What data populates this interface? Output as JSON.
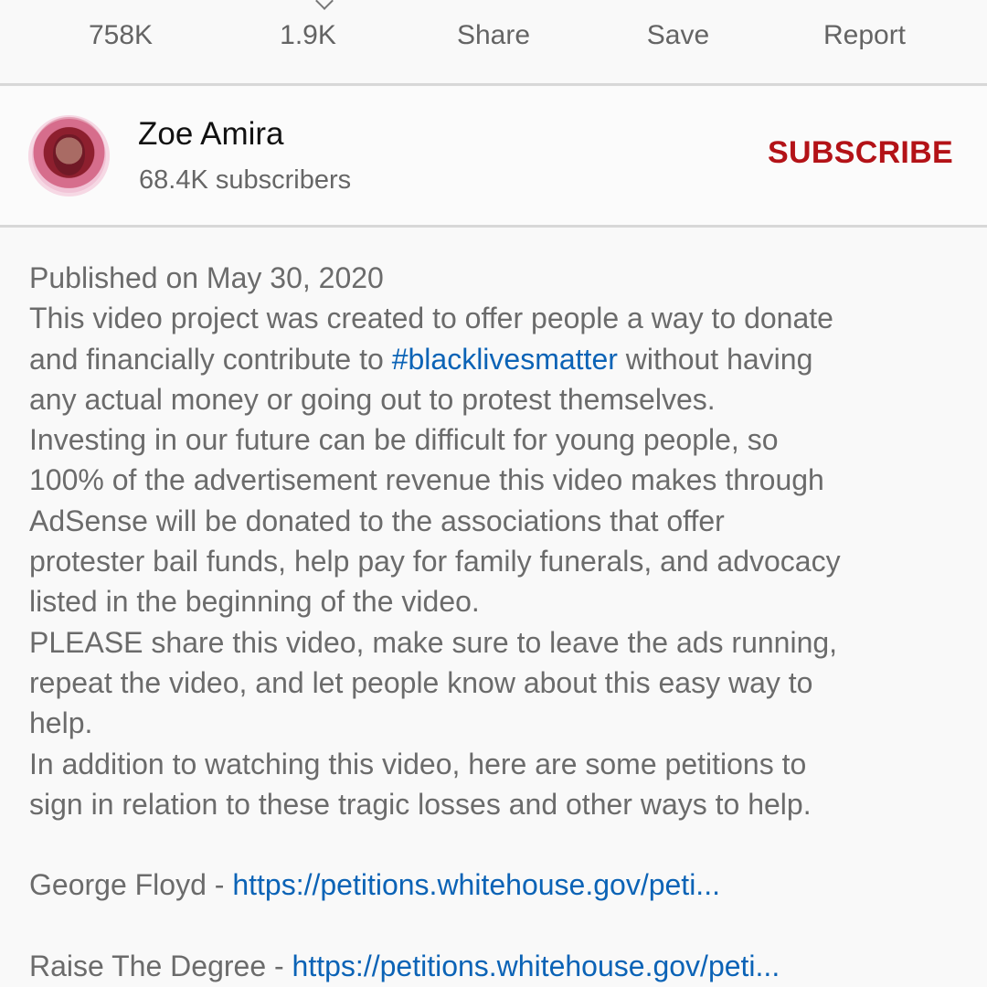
{
  "actions": {
    "likes": "758K",
    "dislikes": "1.9K",
    "share": "Share",
    "save": "Save",
    "report": "Report"
  },
  "channel": {
    "name": "Zoe Amira",
    "subscribers": "68.4K subscribers",
    "subscribe_label": "SUBSCRIBE"
  },
  "description": {
    "published": "Published on May 30, 2020",
    "line1": "This video project was created to offer people a way to donate",
    "line2_before": "and financially contribute to ",
    "hashtag": "#blacklivesmatter",
    "line2_after": " without having",
    "line3": "any actual money or going out to protest themselves.",
    "line4": "Investing in our future can be difficult for young people, so",
    "line5": "100% of the advertisement revenue this video makes through",
    "line6": "AdSense will be donated to the associations that offer",
    "line7": "protester bail funds, help pay for family funerals, and advocacy",
    "line8": "listed in the beginning of the video.",
    "line9": "PLEASE share this video, make sure to leave the ads running,",
    "line10": "repeat the video, and let people know about this easy way to",
    "line11": "help.",
    "line12": "In addition to watching this video, here are some petitions to",
    "line13": "sign in relation to these tragic losses and other ways to help.",
    "petition1_label": "George Floyd - ",
    "petition1_link": "https://petitions.whitehouse.gov/peti...",
    "petition2_label": "Raise The Degree - ",
    "petition2_link": "https://petitions.whitehouse.gov/peti..."
  },
  "colors": {
    "link": "#0b63b6",
    "subscribe": "#b31217",
    "background": "#f9f9f9"
  }
}
